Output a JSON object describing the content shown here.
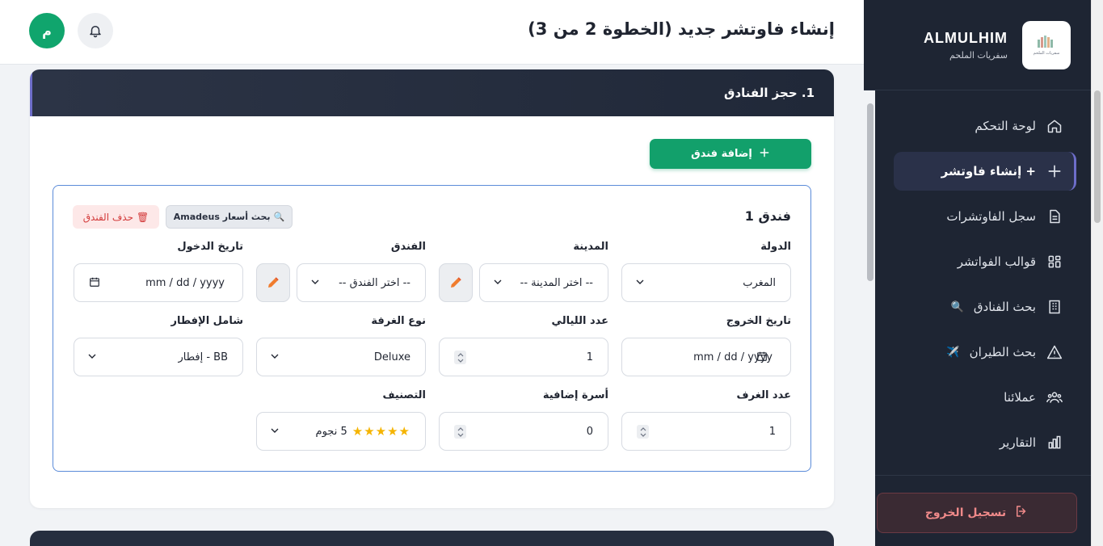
{
  "header": {
    "title": "إنشاء فاوتشر جديد (الخطوة 2 من 3)",
    "avatar_letter": "م"
  },
  "brand": {
    "name": "ALMULHIM",
    "subtitle": "سفريات الملحم",
    "logo_text": "سفريات الملحم"
  },
  "sidebar": {
    "items": [
      {
        "label": "لوحة التحكم",
        "icon": "home-icon"
      },
      {
        "label": "+ إنشاء فاوتشر",
        "icon": "plus-icon",
        "active": true
      },
      {
        "label": "سجل الفاوتشرات",
        "icon": "document-icon"
      },
      {
        "label": "قوالب الفواتشر",
        "icon": "grid-icon"
      },
      {
        "label": "بحث الفنادق",
        "icon": "building-icon",
        "emoji": "🔍"
      },
      {
        "label": "بحث الطيران",
        "icon": "warning-triangle-icon",
        "emoji": "✈️"
      },
      {
        "label": "عملائنا",
        "icon": "users-icon"
      },
      {
        "label": "التقارير",
        "icon": "bar-chart-icon"
      }
    ],
    "logout_label": "تسجيل الخروج"
  },
  "section": {
    "title": "1. حجز الفنادق",
    "add_hotel_label": "إضافة فندق"
  },
  "hotel": {
    "title": "فندق 1",
    "amadeus_label": "بحث أسعار Amadeus",
    "amadeus_emoji": "🔍",
    "delete_label": "حذف الفندق",
    "delete_emoji": "🗑",
    "fields": {
      "country": {
        "label": "الدولة",
        "value": "المغرب"
      },
      "city": {
        "label": "المدينة",
        "value": "-- اختر المدينة --"
      },
      "hotel": {
        "label": "الفندق",
        "value": "-- اختر الفندق --"
      },
      "checkin": {
        "label": "تاريخ الدخول",
        "value": "mm / dd / yyyy"
      },
      "checkout": {
        "label": "تاريخ الخروج",
        "value": "mm / dd / yyyy"
      },
      "nights": {
        "label": "عدد الليالي",
        "value": "1"
      },
      "room_type": {
        "label": "نوع الغرفة",
        "value": "Deluxe"
      },
      "board": {
        "label": "شامل الإفطار",
        "value": "BB - إفطار"
      },
      "rooms": {
        "label": "عدد الغرف",
        "value": "1"
      },
      "extra_beds": {
        "label": "أسرة إضافية",
        "value": "0"
      },
      "rating": {
        "label": "التصنيف",
        "stars": "★★★★★",
        "value": "5 نجوم"
      }
    }
  },
  "colors": {
    "accent_green": "#12a06b",
    "sidebar_bg": "#1e2533",
    "hotel_border": "#5b8bd9",
    "delete_red": "#d33a3a"
  }
}
